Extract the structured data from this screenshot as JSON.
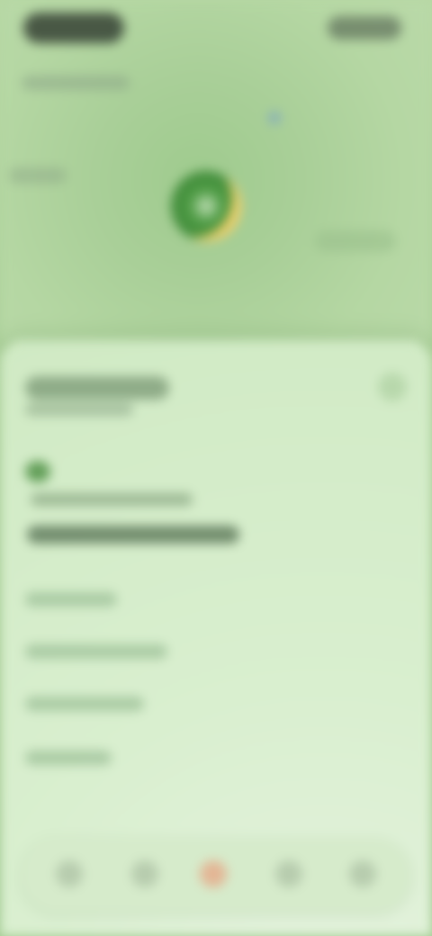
{
  "ui": {
    "accent": "#4f9c45",
    "blurred": true
  },
  "status_bar": {
    "left_label": "",
    "right_label": ""
  },
  "map": {
    "top_label": "",
    "side_label": "",
    "pin_icon": "location-pin-icon"
  },
  "sheet": {
    "title": "",
    "subtitle": "",
    "close_icon": "close-icon",
    "bullet_icon": "dot-icon",
    "primary_text_1": "",
    "primary_text_2": "",
    "links": [
      {
        "label": ""
      },
      {
        "label": ""
      },
      {
        "label": ""
      },
      {
        "label": ""
      }
    ]
  },
  "tab_bar": {
    "tabs": [
      {
        "icon": "home-icon",
        "label": ""
      },
      {
        "icon": "list-icon",
        "label": ""
      },
      {
        "icon": "center-icon",
        "label": ""
      },
      {
        "icon": "stats-icon",
        "label": ""
      },
      {
        "icon": "profile-icon",
        "label": ""
      }
    ]
  }
}
